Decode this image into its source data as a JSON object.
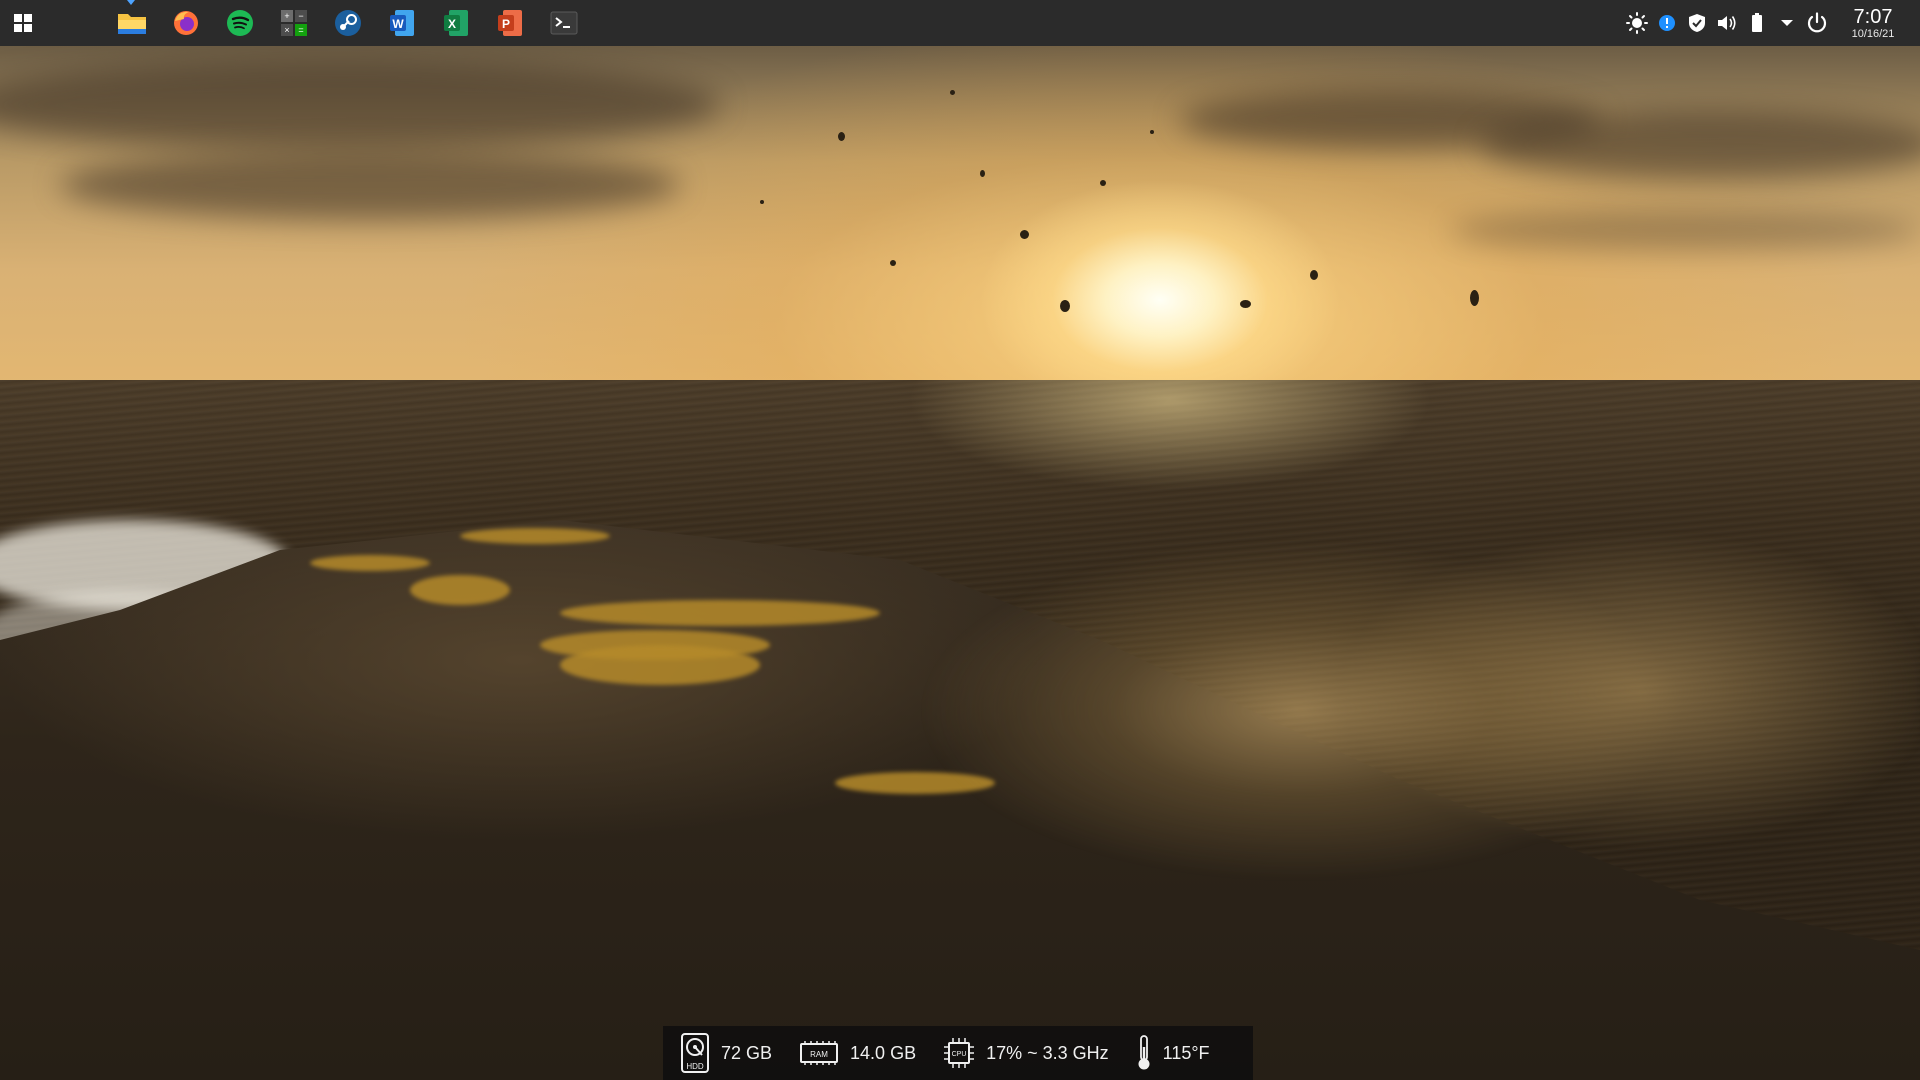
{
  "taskbar": {
    "start_icon": "windows-logo-icon",
    "apps": [
      {
        "name": "file-explorer",
        "icon": "folder-icon",
        "color": "#f6c342",
        "active": true
      },
      {
        "name": "firefox",
        "icon": "firefox-icon",
        "color": "#ff7139"
      },
      {
        "name": "spotify",
        "icon": "spotify-icon",
        "color": "#1db954"
      },
      {
        "name": "calculator",
        "icon": "calculator-icon",
        "color": "#6d6d6d"
      },
      {
        "name": "steam",
        "icon": "steam-icon",
        "color": "#1b5f9e"
      },
      {
        "name": "word",
        "icon": "word-icon",
        "color": "#2b579a",
        "letter": "W"
      },
      {
        "name": "excel",
        "icon": "excel-icon",
        "color": "#217346",
        "letter": "X"
      },
      {
        "name": "powerpoint",
        "icon": "powerpoint-icon",
        "color": "#d24726",
        "letter": "P"
      },
      {
        "name": "terminal",
        "icon": "terminal-icon",
        "color": "#3a3a3a"
      }
    ],
    "tray": {
      "icons": [
        "brightness-icon",
        "info-icon",
        "shield-icon",
        "volume-icon",
        "battery-icon",
        "chevron-down-icon",
        "power-icon"
      ],
      "time": "7:07",
      "date": "10/16/21"
    }
  },
  "monitor": {
    "hdd_label": "HDD",
    "hdd_value": "72 GB",
    "ram_label": "RAM",
    "ram_value": "14.0 GB",
    "cpu_label": "CPU",
    "cpu_value": "17% ~ 3.3 GHz",
    "temp_value": "115°F"
  }
}
